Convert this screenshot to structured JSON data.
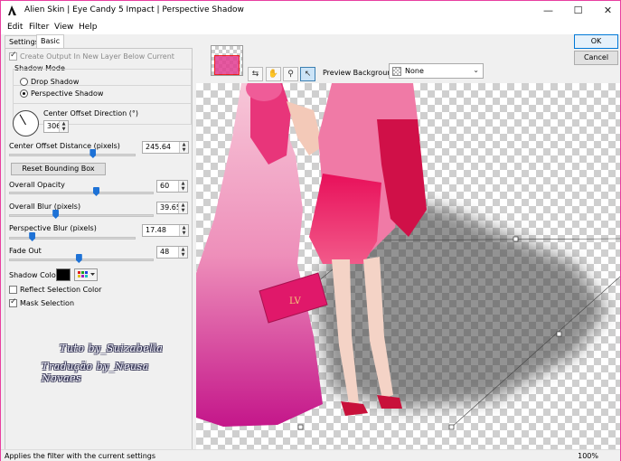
{
  "window": {
    "title": "Alien Skin | Eye Candy 5 Impact | Perspective Shadow",
    "minimize_glyph": "—",
    "maximize_glyph": "☐",
    "close_glyph": "✕"
  },
  "menu": [
    "Edit",
    "Filter",
    "View",
    "Help"
  ],
  "tabs": [
    "Settings",
    "Basic"
  ],
  "controls": {
    "create_output_label": "Create Output In New Layer Below Current",
    "shadow_mode_label": "Shadow Mode",
    "drop_shadow_label": "Drop Shadow",
    "perspective_shadow_label": "Perspective Shadow",
    "center_offset_direction_label": "Center Offset Direction (°)",
    "center_offset_direction_value": "306",
    "center_offset_distance_label": "Center Offset Distance (pixels)",
    "center_offset_distance_value": "245.64",
    "reset_bounding_box_label": "Reset Bounding Box",
    "overall_opacity_label": "Overall Opacity",
    "overall_opacity_value": "60",
    "overall_blur_label": "Overall Blur (pixels)",
    "overall_blur_value": "39.65",
    "perspective_blur_label": "Perspective Blur (pixels)",
    "perspective_blur_value": "17.48",
    "fade_out_label": "Fade Out",
    "fade_out_value": "48",
    "shadow_color_label": "Shadow Color",
    "reflect_selection_color_label": "Reflect Selection Color",
    "mask_selection_label": "Mask Selection"
  },
  "slider_levels": {
    "center_offset_distance": 0.66,
    "overall_opacity": 0.6,
    "overall_blur": 0.32,
    "perspective_blur": 0.18,
    "fade_out": 0.48
  },
  "watermark": {
    "line1": "Tuto by_Suizabella",
    "line2": "Tradução by_Neusa Novaes"
  },
  "preview": {
    "background_label": "Preview Background:",
    "background_value": "None"
  },
  "buttons": {
    "ok": "OK",
    "cancel": "Cancel"
  },
  "status": {
    "text": "Applies the filter with the current settings",
    "zoom": "100%"
  },
  "icons": {
    "hand": "hand-icon",
    "zoom": "zoom-icon",
    "pointer": "pointer-icon",
    "toggle": "toggle-preview-icon"
  },
  "colors": {
    "accent": "#1e72d6",
    "shadow_color": "#000000",
    "frame": "#e83fa0"
  }
}
